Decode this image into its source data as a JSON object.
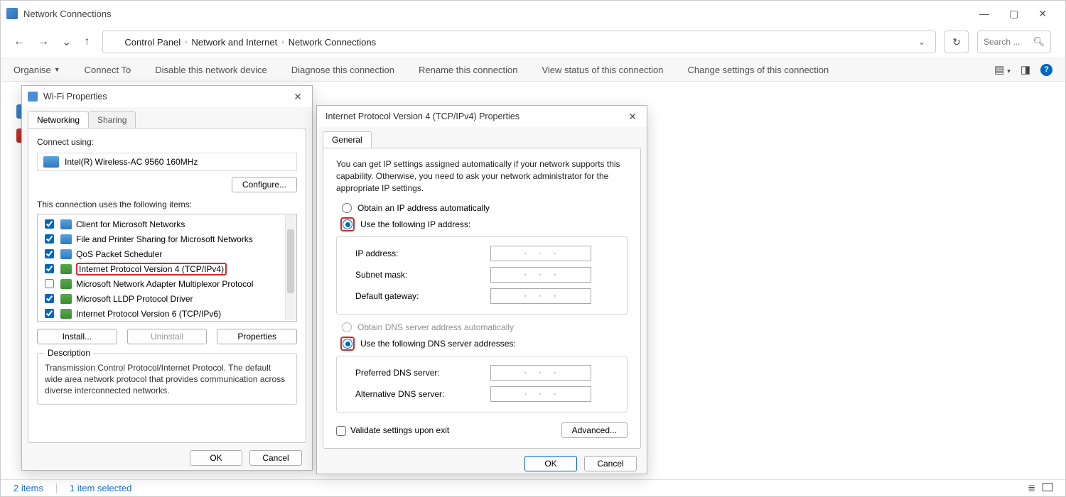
{
  "main": {
    "title": "Network Connections",
    "breadcrumbs": [
      "Control Panel",
      "Network and Internet",
      "Network Connections"
    ],
    "search_placeholder": "Search ...",
    "commands": {
      "organise": "Organise",
      "connect_to": "Connect To",
      "disable": "Disable this network device",
      "diagnose": "Diagnose this connection",
      "rename": "Rename this connection",
      "view_status": "View status of this connection",
      "change_settings": "Change settings of this connection"
    },
    "status": {
      "items": "2 items",
      "selected": "1 item selected"
    }
  },
  "wifi": {
    "title": "Wi-Fi Properties",
    "tabs": {
      "networking": "Networking",
      "sharing": "Sharing"
    },
    "connect_using_label": "Connect using:",
    "adapter": "Intel(R) Wireless-AC 9560 160MHz",
    "configure": "Configure...",
    "uses_label": "This connection uses the following items:",
    "items": [
      {
        "checked": true,
        "iconBlue": true,
        "label": "Client for Microsoft Networks"
      },
      {
        "checked": true,
        "iconBlue": true,
        "label": "File and Printer Sharing for Microsoft Networks"
      },
      {
        "checked": true,
        "iconBlue": true,
        "label": "QoS Packet Scheduler"
      },
      {
        "checked": true,
        "iconBlue": false,
        "label": "Internet Protocol Version 4 (TCP/IPv4)",
        "selected": true
      },
      {
        "checked": false,
        "iconBlue": false,
        "label": "Microsoft Network Adapter Multiplexor Protocol"
      },
      {
        "checked": true,
        "iconBlue": false,
        "label": "Microsoft LLDP Protocol Driver"
      },
      {
        "checked": true,
        "iconBlue": false,
        "label": "Internet Protocol Version 6 (TCP/IPv6)"
      }
    ],
    "install": "Install...",
    "uninstall": "Uninstall",
    "properties": "Properties",
    "desc_label": "Description",
    "desc_text": "Transmission Control Protocol/Internet Protocol. The default wide area network protocol that provides communication across diverse interconnected networks.",
    "ok": "OK",
    "cancel": "Cancel"
  },
  "ipv4": {
    "title": "Internet Protocol Version 4 (TCP/IPv4) Properties",
    "tab": "General",
    "intro": "You can get IP settings assigned automatically if your network supports this capability. Otherwise, you need to ask your network administrator for the appropriate IP settings.",
    "obtain_ip": "Obtain an IP address automatically",
    "use_ip": "Use the following IP address:",
    "ip_address": "IP address:",
    "subnet": "Subnet mask:",
    "gateway": "Default gateway:",
    "obtain_dns": "Obtain DNS server address automatically",
    "use_dns": "Use the following DNS server addresses:",
    "pref_dns": "Preferred DNS server:",
    "alt_dns": "Alternative DNS server:",
    "validate": "Validate settings upon exit",
    "advanced": "Advanced...",
    "ok": "OK",
    "cancel": "Cancel"
  }
}
